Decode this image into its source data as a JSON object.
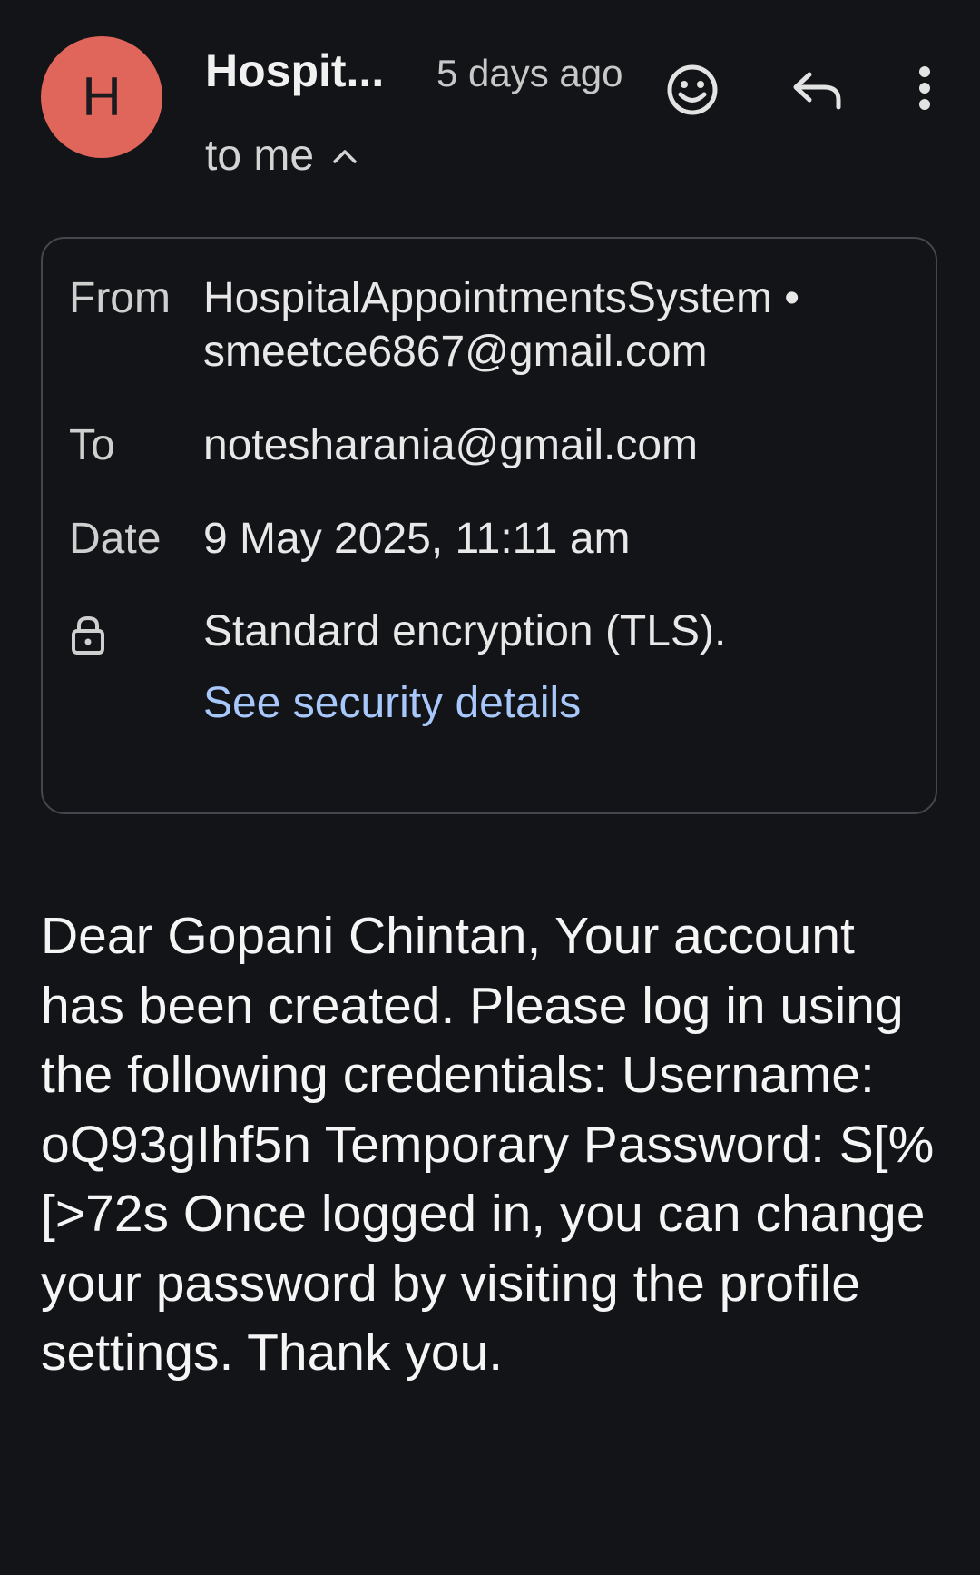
{
  "header": {
    "avatar_letter": "H",
    "sender_short": "Hospit...",
    "time_ago": "5 days ago",
    "recipient_summary": "to me",
    "icons": [
      "emoji-icon",
      "reply-icon",
      "more-vert-icon",
      "chevron-up-icon"
    ]
  },
  "details": {
    "from_label": "From",
    "from_name": "HospitalAppointmentsSystem •",
    "from_email": "smeetce6867@gmail.com",
    "to_label": "To",
    "to_email": "notesharania@gmail.com",
    "date_label": "Date",
    "date_value": "9 May 2025, 11:11 am",
    "encryption_text": "Standard encryption (TLS).",
    "security_link": "See security details",
    "icons": [
      "lock-icon"
    ]
  },
  "message": {
    "body": "Dear Gopani Chintan, Your account has been created. Please log in using the following credentials: Username: oQ93gIhf5n Temporary Password: S[%[>72s Once logged in, you can change your password by visiting the profile settings. Thank you."
  },
  "colors": {
    "background": "#131418",
    "avatar": "#e0655a",
    "link": "#a8c7fa",
    "card_border": "#44474d"
  }
}
